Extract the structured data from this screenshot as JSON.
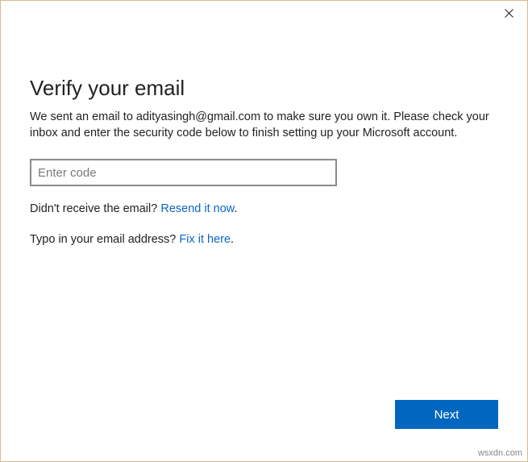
{
  "dialog": {
    "heading": "Verify your email",
    "description": "We sent an email to adityasingh@gmail.com to make sure you own it. Please check your inbox and enter the security code below to finish setting up your Microsoft account.",
    "code_placeholder": "Enter code",
    "resend_prefix": "Didn't receive the email? ",
    "resend_link": "Resend it now",
    "typo_prefix": "Typo in your email address? ",
    "typo_link": "Fix it here",
    "period": ".",
    "next_label": "Next"
  },
  "watermark": "wsxdn.com"
}
